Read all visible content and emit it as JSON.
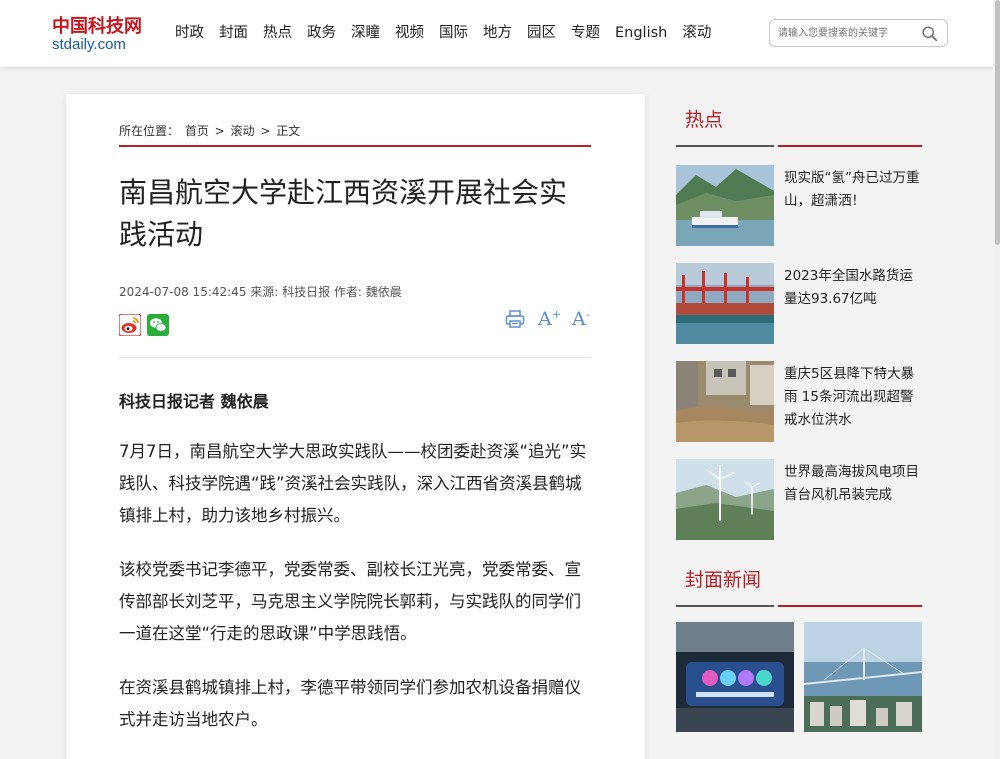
{
  "logo": {
    "cn": "中国科技网",
    "en": "stdaily.com"
  },
  "nav": [
    "时政",
    "封面",
    "热点",
    "政务",
    "深瞳",
    "视频",
    "国际",
    "地方",
    "园区",
    "专题",
    "English",
    "滚动"
  ],
  "search": {
    "placeholder": "请输入您要搜索的关键字"
  },
  "breadcrumb": {
    "prefix": "所在位置：",
    "home": "首页",
    "sep1": " > ",
    "section": "滚动",
    "sep2": " > ",
    "current": "正文"
  },
  "article": {
    "title": "南昌航空大学赴江西资溪开展社会实践活动",
    "meta": "2024-07-08 15:42:45 来源: 科技日报 作者: 魏依晨",
    "byline": "科技日报记者 魏依晨",
    "paragraphs": [
      "7月7日，南昌航空大学大思政实践队——校团委赴资溪“追光”实践队、科技学院遇“践”资溪社会实践队，深入江西省资溪县鹤城镇排上村，助力该地乡村振兴。",
      "该校党委书记李德平，党委常委、副校长江光亮，党委常委、宣传部部长刘芝平，马克思主义学院院长郭莉，与实践队的同学们一道在这堂“行走的思政课”中学思践悟。",
      "在资溪县鹤城镇排上村，李德平带领同学们参加农机设备捐赠仪式并走访当地农户。"
    ]
  },
  "tools": {
    "font_up": "A",
    "font_up_sign": "+",
    "font_down": "A",
    "font_down_sign": "-"
  },
  "sidebar": {
    "hot_title": "热点",
    "hot_items": [
      {
        "text": "现实版“氢”舟已过万重山，超潇洒！"
      },
      {
        "text": "2023年全国水路货运量达93.67亿吨"
      },
      {
        "text": "重庆5区县降下特大暴雨 15条河流出现超警戒水位洪水"
      },
      {
        "text": "世界最高海拔风电项目首台风机吊装完成"
      }
    ],
    "cover_title": "封面新闻"
  },
  "colors": {
    "brand_red": "#b32025",
    "link_blue": "#1a57a8",
    "tool_blue": "#5a8fd6",
    "wechat_green": "#2aae3a"
  }
}
